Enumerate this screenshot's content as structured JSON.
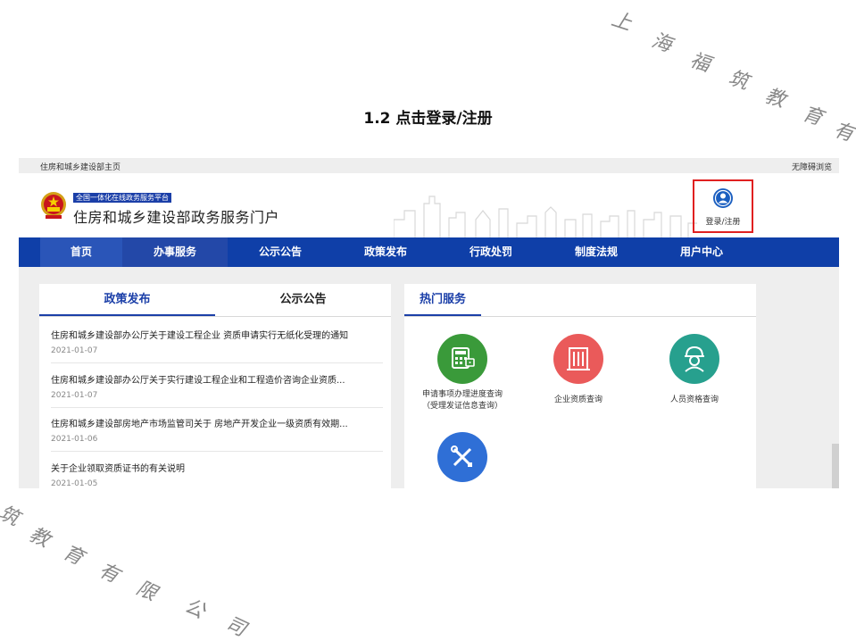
{
  "slide": {
    "title": "1.2 点击登录/注册",
    "watermark_top": [
      "上",
      "海",
      "福",
      "筑",
      "教",
      "育",
      "有"
    ],
    "watermark_bottom": [
      "筑",
      "教",
      "育",
      "有",
      "限",
      "公",
      "司"
    ]
  },
  "topbar": {
    "home_link": "住房和城乡建设部主页",
    "accessibility": "无障碍浏览"
  },
  "header": {
    "portal_tag": "全国一体化在线政务服务平台",
    "portal_name": "住房和城乡建设部政务服务门户",
    "login_label": "登录/注册",
    "login_icon": "user-circle-icon",
    "highlight_color": "#e02020"
  },
  "nav": {
    "items": [
      "首页",
      "办事服务",
      "公示公告",
      "政策发布",
      "行政处罚",
      "制度法规",
      "用户中心"
    ],
    "active_index": 1,
    "color": "#0f3fa8"
  },
  "left_panel": {
    "tabs": [
      "政策发布",
      "公示公告"
    ],
    "news": [
      {
        "title": "住房和城乡建设部办公厅关于建设工程企业 资质申请实行无纸化受理的通知",
        "date": "2021-01-07"
      },
      {
        "title": "住房和城乡建设部办公厅关于实行建设工程企业和工程造价咨询企业资质...",
        "date": "2021-01-07"
      },
      {
        "title": "住房和城乡建设部房地产市场监管司关于 房地产开发企业一级资质有效期...",
        "date": "2021-01-06"
      },
      {
        "title": "关于企业领取资质证书的有关说明",
        "date": "2021-01-05"
      }
    ]
  },
  "right_panel": {
    "tab": "热门服务",
    "services": [
      {
        "label_line1": "申请事项办理进度查询",
        "label_line2": "（受理发证信息查询）",
        "icon": "calculator-icon",
        "color": "#3a9a3a"
      },
      {
        "label_line1": "企业资质查询",
        "label_line2": "",
        "icon": "building-icon",
        "color": "#ea5a5a"
      },
      {
        "label_line1": "人员资格查询",
        "label_line2": "",
        "icon": "worker-helmet-icon",
        "color": "#27a08e"
      },
      {
        "label_line1": "",
        "label_line2": "",
        "icon": "tools-icon",
        "color": "#2f6fd6"
      }
    ]
  }
}
